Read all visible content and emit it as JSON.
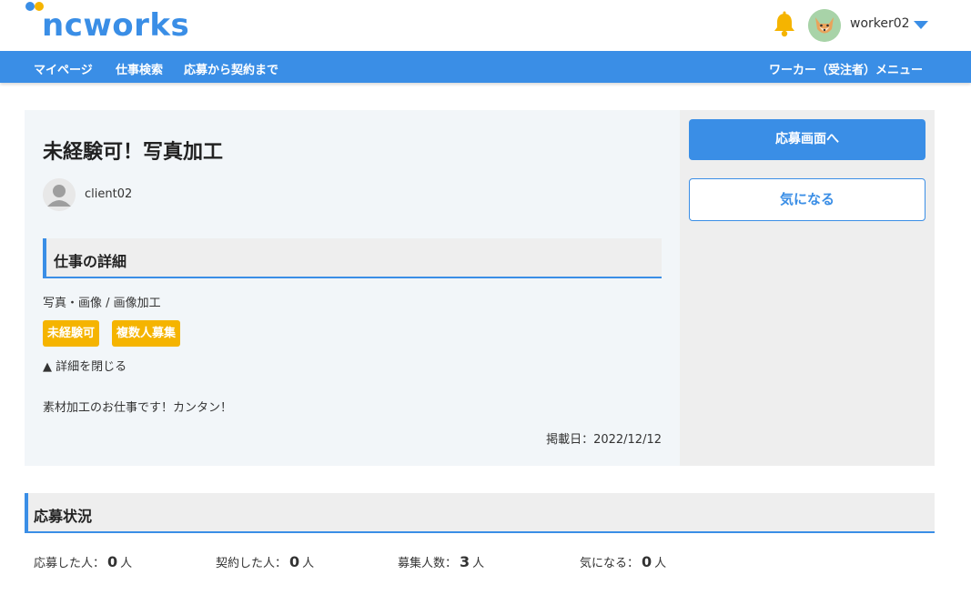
{
  "header": {
    "logo_text": "ncworks",
    "username": "worker02",
    "brand_color": "#3a8ee6",
    "accent_color": "#f5b400"
  },
  "nav": {
    "items": [
      "マイページ",
      "仕事検索",
      "応募から契約まで"
    ],
    "right_menu": "ワーカー（受注者）メニュー"
  },
  "job": {
    "title": "未経験可！写真加工",
    "client": "client02",
    "section_title": "仕事の詳細",
    "category": "写真・画像 / 画像加工",
    "tags": [
      "未経験可",
      "複数人募集"
    ],
    "toggle_label": "▲ 詳細を閉じる",
    "description": "素材加工のお仕事です！カンタン！",
    "posted_label": "掲載日：2022/12/12"
  },
  "actions": {
    "apply_label": "応募画面へ",
    "favorite_label": "気になる"
  },
  "status": {
    "title": "応募状況",
    "stats": [
      {
        "label": "応募した人：",
        "value": "0",
        "unit": "人"
      },
      {
        "label": "契約した人：",
        "value": "0",
        "unit": "人"
      },
      {
        "label": "募集人数：",
        "value": "3",
        "unit": "人"
      },
      {
        "label": "気になる：",
        "value": "0",
        "unit": "人"
      }
    ]
  },
  "icons": {
    "bell": "bell-icon",
    "user_avatar": "fox-avatar-icon",
    "client_avatar": "person-avatar-icon",
    "caret": "caret-down-icon"
  }
}
